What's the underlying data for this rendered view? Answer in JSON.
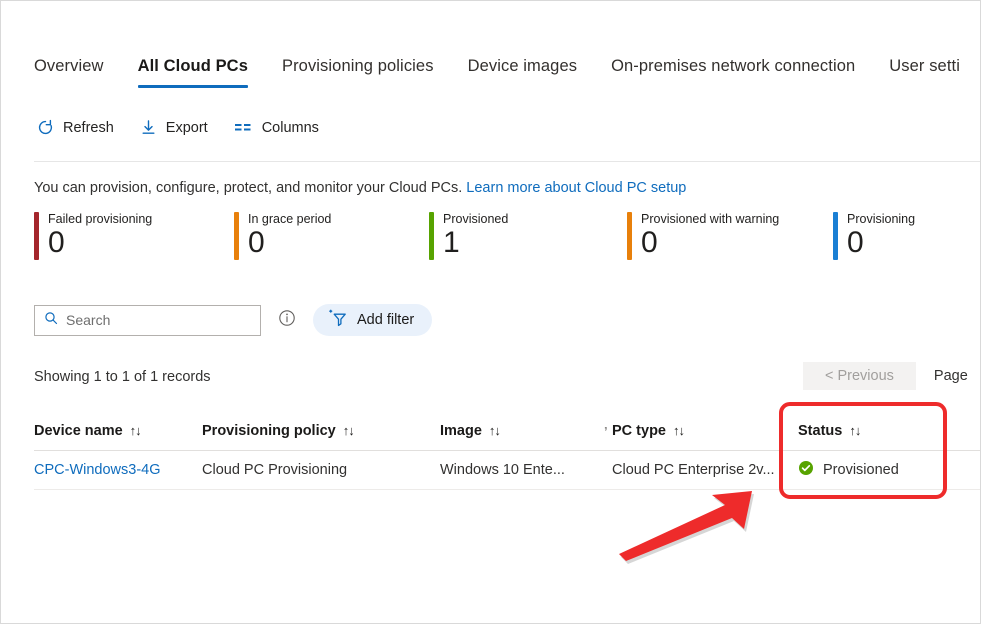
{
  "tabs": [
    {
      "label": "Overview",
      "active": false
    },
    {
      "label": "All Cloud PCs",
      "active": true
    },
    {
      "label": "Provisioning policies",
      "active": false
    },
    {
      "label": "Device images",
      "active": false
    },
    {
      "label": "On-premises network connection",
      "active": false
    },
    {
      "label": "User setti",
      "active": false
    }
  ],
  "toolbar": {
    "refresh_label": "Refresh",
    "export_label": "Export",
    "columns_label": "Columns"
  },
  "description": {
    "text": "You can provision, configure, protect, and monitor your Cloud PCs.",
    "link_text": "Learn more about Cloud PC setup"
  },
  "tiles": [
    {
      "label": "Failed provisioning",
      "count": "0",
      "color": "#a4262c"
    },
    {
      "label": "In grace period",
      "count": "0",
      "color": "#e8800b"
    },
    {
      "label": "Provisioned",
      "count": "1",
      "color": "#57a300"
    },
    {
      "label": "Provisioned with warning",
      "count": "0",
      "color": "#e8800b"
    },
    {
      "label": "Provisioning",
      "count": "0",
      "color": "#1a7fd4"
    }
  ],
  "search": {
    "placeholder": "Search",
    "value": "",
    "add_filter_label": "Add filter"
  },
  "results": {
    "records_text": "Showing 1 to 1 of 1 records",
    "previous_label": "< Previous",
    "page_label": "Page"
  },
  "table": {
    "columns": [
      {
        "label": "Device name",
        "sort": "↑↓"
      },
      {
        "label": "Provisioning policy",
        "sort": "↑↓"
      },
      {
        "label": "Image",
        "sort": "↑↓"
      },
      {
        "label": "PC type",
        "sort": "↑↓"
      },
      {
        "label": "Status",
        "sort": "↑↓"
      }
    ],
    "rows": [
      {
        "device_name": "CPC-Windows3-4G",
        "provisioning_policy": "Cloud PC Provisioning",
        "image": "Windows 10 Ente...",
        "pc_type": "Cloud PC Enterprise 2v...",
        "status": "Provisioned"
      }
    ]
  },
  "colors": {
    "accent": "#0f6cbd",
    "link": "#0f6cbd",
    "annotation_red": "#ee2b2b",
    "status_green": "#57a300"
  }
}
